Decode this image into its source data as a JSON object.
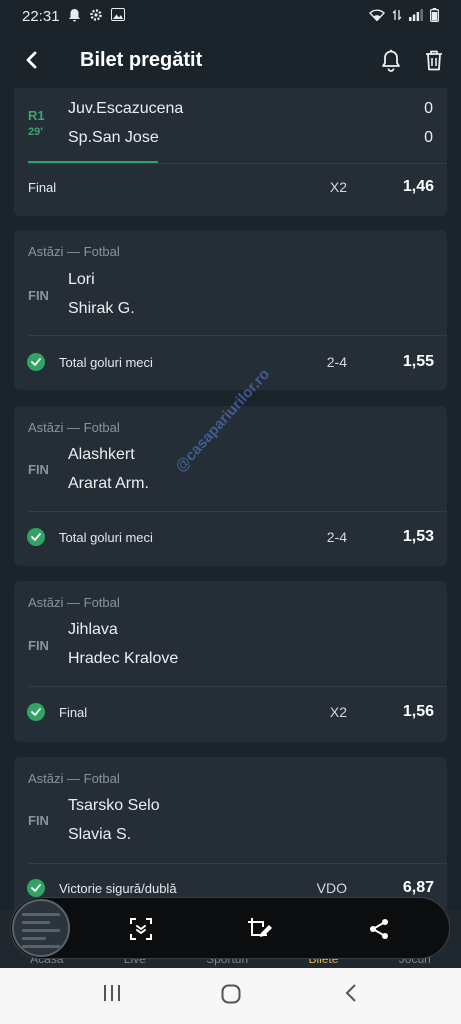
{
  "status_bar": {
    "time": "22:31"
  },
  "header": {
    "title": "Bilet pregătit"
  },
  "cards": [
    {
      "period": "R1",
      "minute": "29'",
      "home": "Juv.Escazucena",
      "away": "Sp.San Jose",
      "home_score": "0",
      "away_score": "0",
      "market": "Final",
      "pick": "X2",
      "odd": "1,46"
    },
    {
      "meta": "Astăzi — Fotbal",
      "status": "FIN",
      "home": "Lori",
      "away": "Shirak G.",
      "market": "Total goluri meci",
      "pick": "2-4",
      "odd": "1,55"
    },
    {
      "meta": "Astăzi — Fotbal",
      "status": "FIN",
      "home": "Alashkert",
      "away": "Ararat Arm.",
      "market": "Total goluri meci",
      "pick": "2-4",
      "odd": "1,53"
    },
    {
      "meta": "Astăzi — Fotbal",
      "status": "FIN",
      "home": "Jihlava",
      "away": "Hradec Kralove",
      "market": "Final",
      "pick": "X2",
      "odd": "1,56"
    },
    {
      "meta": "Astăzi — Fotbal",
      "status": "FIN",
      "home": "Tsarsko Selo",
      "away": "Slavia S.",
      "market": "Victorie sigură/dublă",
      "pick": "VDO",
      "odd": "6,87"
    }
  ],
  "watermark": "@casapariurilor.ro",
  "bottom_nav": {
    "items": [
      "Acasă",
      "Live",
      "Sporturi",
      "Bilete",
      "Jocuri"
    ],
    "active": "Bilete",
    "active_color": "#e6b54a"
  },
  "colors": {
    "background": "#1b232b",
    "card": "#252e37",
    "accent_green": "#2fa463"
  },
  "icons": {
    "header": [
      "back-arrow-icon",
      "bell-icon",
      "trash-icon"
    ],
    "toolbar": [
      "scroll-capture-icon",
      "crop-edit-icon",
      "share-icon"
    ],
    "system_nav": [
      "recents-icon",
      "home-icon",
      "back-icon"
    ]
  }
}
